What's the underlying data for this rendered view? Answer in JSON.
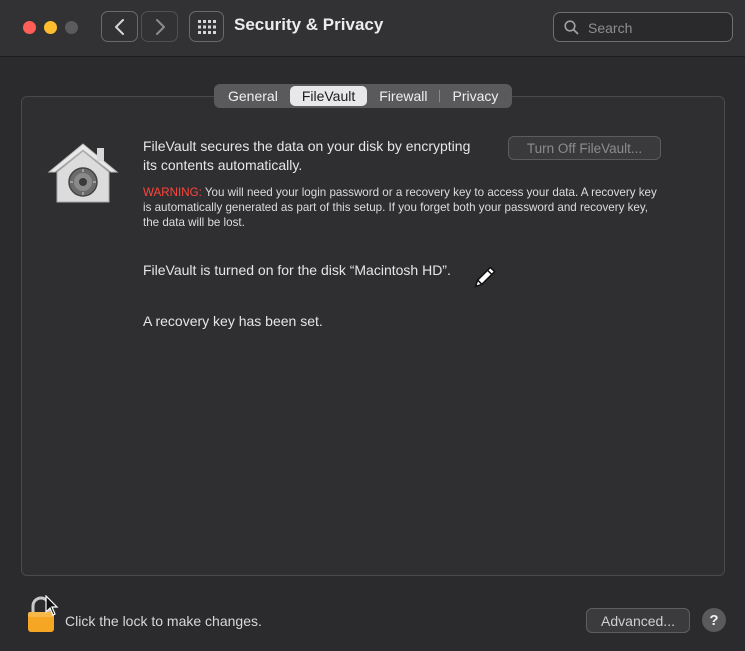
{
  "window": {
    "title": "Security & Privacy",
    "search_placeholder": "Search"
  },
  "tabs": [
    {
      "label": "General",
      "active": false
    },
    {
      "label": "FileVault",
      "active": true
    },
    {
      "label": "Firewall",
      "active": false
    },
    {
      "label": "Privacy",
      "active": false
    }
  ],
  "filevault": {
    "description": "FileVault secures the data on your disk by encrypting its contents automatically.",
    "turn_off_button": "Turn Off FileVault...",
    "warning_label": "WARNING:",
    "warning_text": " You will need your login password or a recovery key to access your data. A recovery key is automatically generated as part of this setup. If you forget both your password and recovery key, the data will be lost.",
    "status_disk": "FileVault is turned on for the disk “Macintosh HD”.",
    "status_key": "A recovery key has been set."
  },
  "footer": {
    "lock_text": "Click the lock to make changes.",
    "advanced_button": "Advanced...",
    "help_button": "?"
  },
  "icons": [
    "back-chevron-icon",
    "forward-chevron-icon",
    "grid-icon",
    "search-icon",
    "filevault-house-icon",
    "pencil-cursor-icon",
    "lock-icon",
    "pointer-cursor-icon"
  ],
  "colors": {
    "close": "#ff5f57",
    "minimize": "#febc2e",
    "warning": "#ff453a",
    "lock": "#f5a623"
  }
}
